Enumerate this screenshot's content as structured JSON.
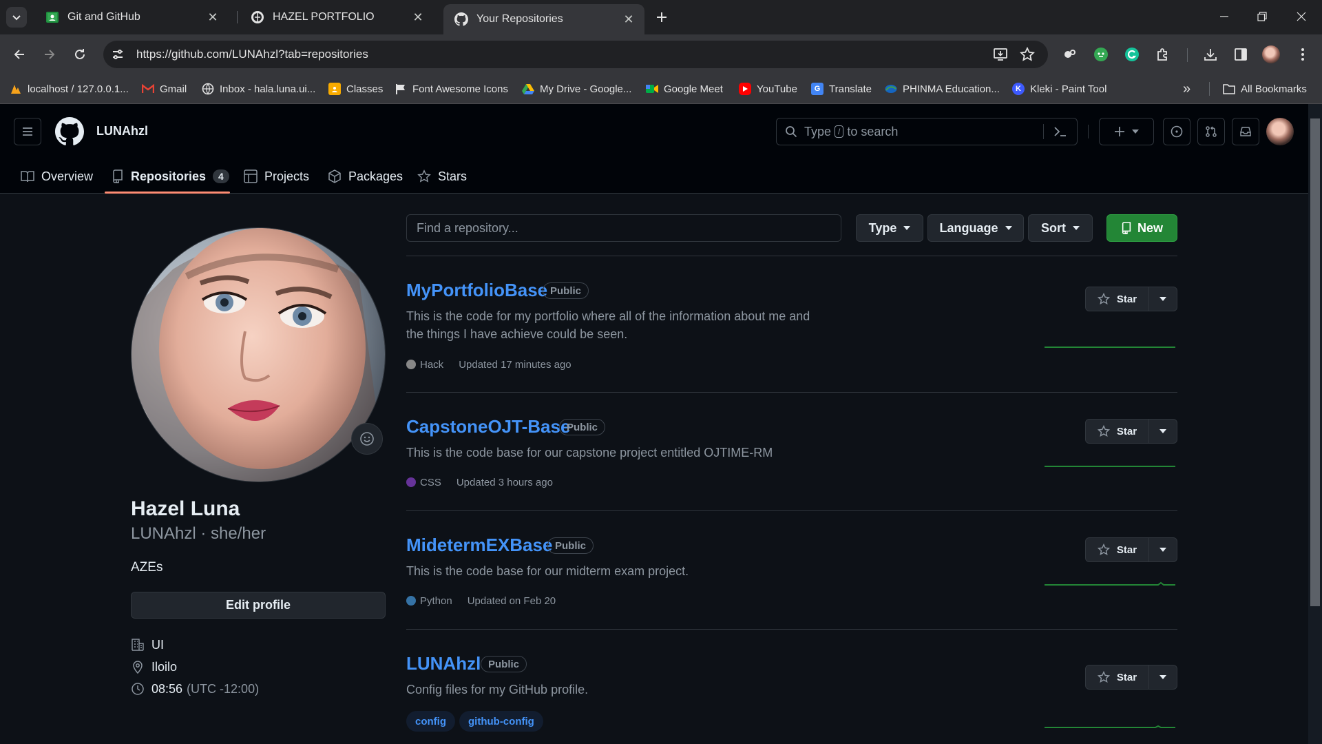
{
  "browser": {
    "tabs": [
      {
        "title": "Git and GitHub",
        "icon": "google-classroom-icon"
      },
      {
        "title": "HAZEL PORTFOLIO",
        "icon": "site-globe-icon"
      },
      {
        "title": "Your Repositories",
        "icon": "github-icon",
        "active": true
      }
    ],
    "url": "https://github.com/LUNAhzl?tab=repositories",
    "bookmarks": [
      {
        "label": "localhost / 127.0.0.1...",
        "icon": "phpmyadmin-icon"
      },
      {
        "label": "Gmail",
        "icon": "gmail-icon"
      },
      {
        "label": "Inbox - hala.luna.ui...",
        "icon": "mail-icon"
      },
      {
        "label": "Classes",
        "icon": "classroom-icon"
      },
      {
        "label": "Font Awesome Icons",
        "icon": "flag-icon"
      },
      {
        "label": "My Drive - Google...",
        "icon": "drive-icon"
      },
      {
        "label": "Google Meet",
        "icon": "meet-icon"
      },
      {
        "label": "YouTube",
        "icon": "youtube-icon"
      },
      {
        "label": "Translate",
        "icon": "translate-icon"
      },
      {
        "label": "PHINMA Education...",
        "icon": "phinma-icon"
      },
      {
        "label": "Kleki - Paint Tool",
        "icon": "kleki-icon"
      }
    ],
    "all_bookmarks": "All Bookmarks"
  },
  "header": {
    "owner": "LUNAhzl",
    "search_prefix": "Type",
    "search_key": "/",
    "search_suffix": "to search"
  },
  "nav": {
    "overview": "Overview",
    "repositories": "Repositories",
    "repositories_count": "4",
    "projects": "Projects",
    "packages": "Packages",
    "stars": "Stars"
  },
  "profile": {
    "name": "Hazel Luna",
    "handle": "LUNAhzl · she/her",
    "bio": "AZEs",
    "edit_label": "Edit profile",
    "organization": "UI",
    "location": "Iloilo",
    "local_time": "08:56",
    "timezone": "(UTC -12:00)"
  },
  "filters": {
    "find_placeholder": "Find a repository...",
    "type": "Type",
    "language": "Language",
    "sort": "Sort",
    "new": "New"
  },
  "repos": [
    {
      "name": "MyPortfolioBase",
      "visibility": "Public",
      "description": "This is the code for my portfolio where all of the information about me and the things I have achieve could be seen.",
      "language": "Hack",
      "language_color": "#878787",
      "updated": "Updated 17 minutes ago",
      "star_label": "Star"
    },
    {
      "name": "CapstoneOJT-Base",
      "visibility": "Public",
      "description": "This is the code base for our capstone project entitled OJTIME-RM",
      "language": "CSS",
      "language_color": "#663399",
      "updated": "Updated 3 hours ago",
      "star_label": "Star"
    },
    {
      "name": "MidetermEXBase",
      "visibility": "Public",
      "description": "This is the code base for our midterm exam project.",
      "language": "Python",
      "language_color": "#3572A5",
      "updated": "Updated on Feb 20",
      "star_label": "Star"
    },
    {
      "name": "LUNAhzl",
      "visibility": "Public",
      "description": "Config files for my GitHub profile.",
      "topics": [
        "config",
        "github-config"
      ],
      "star_label": "Star"
    }
  ]
}
